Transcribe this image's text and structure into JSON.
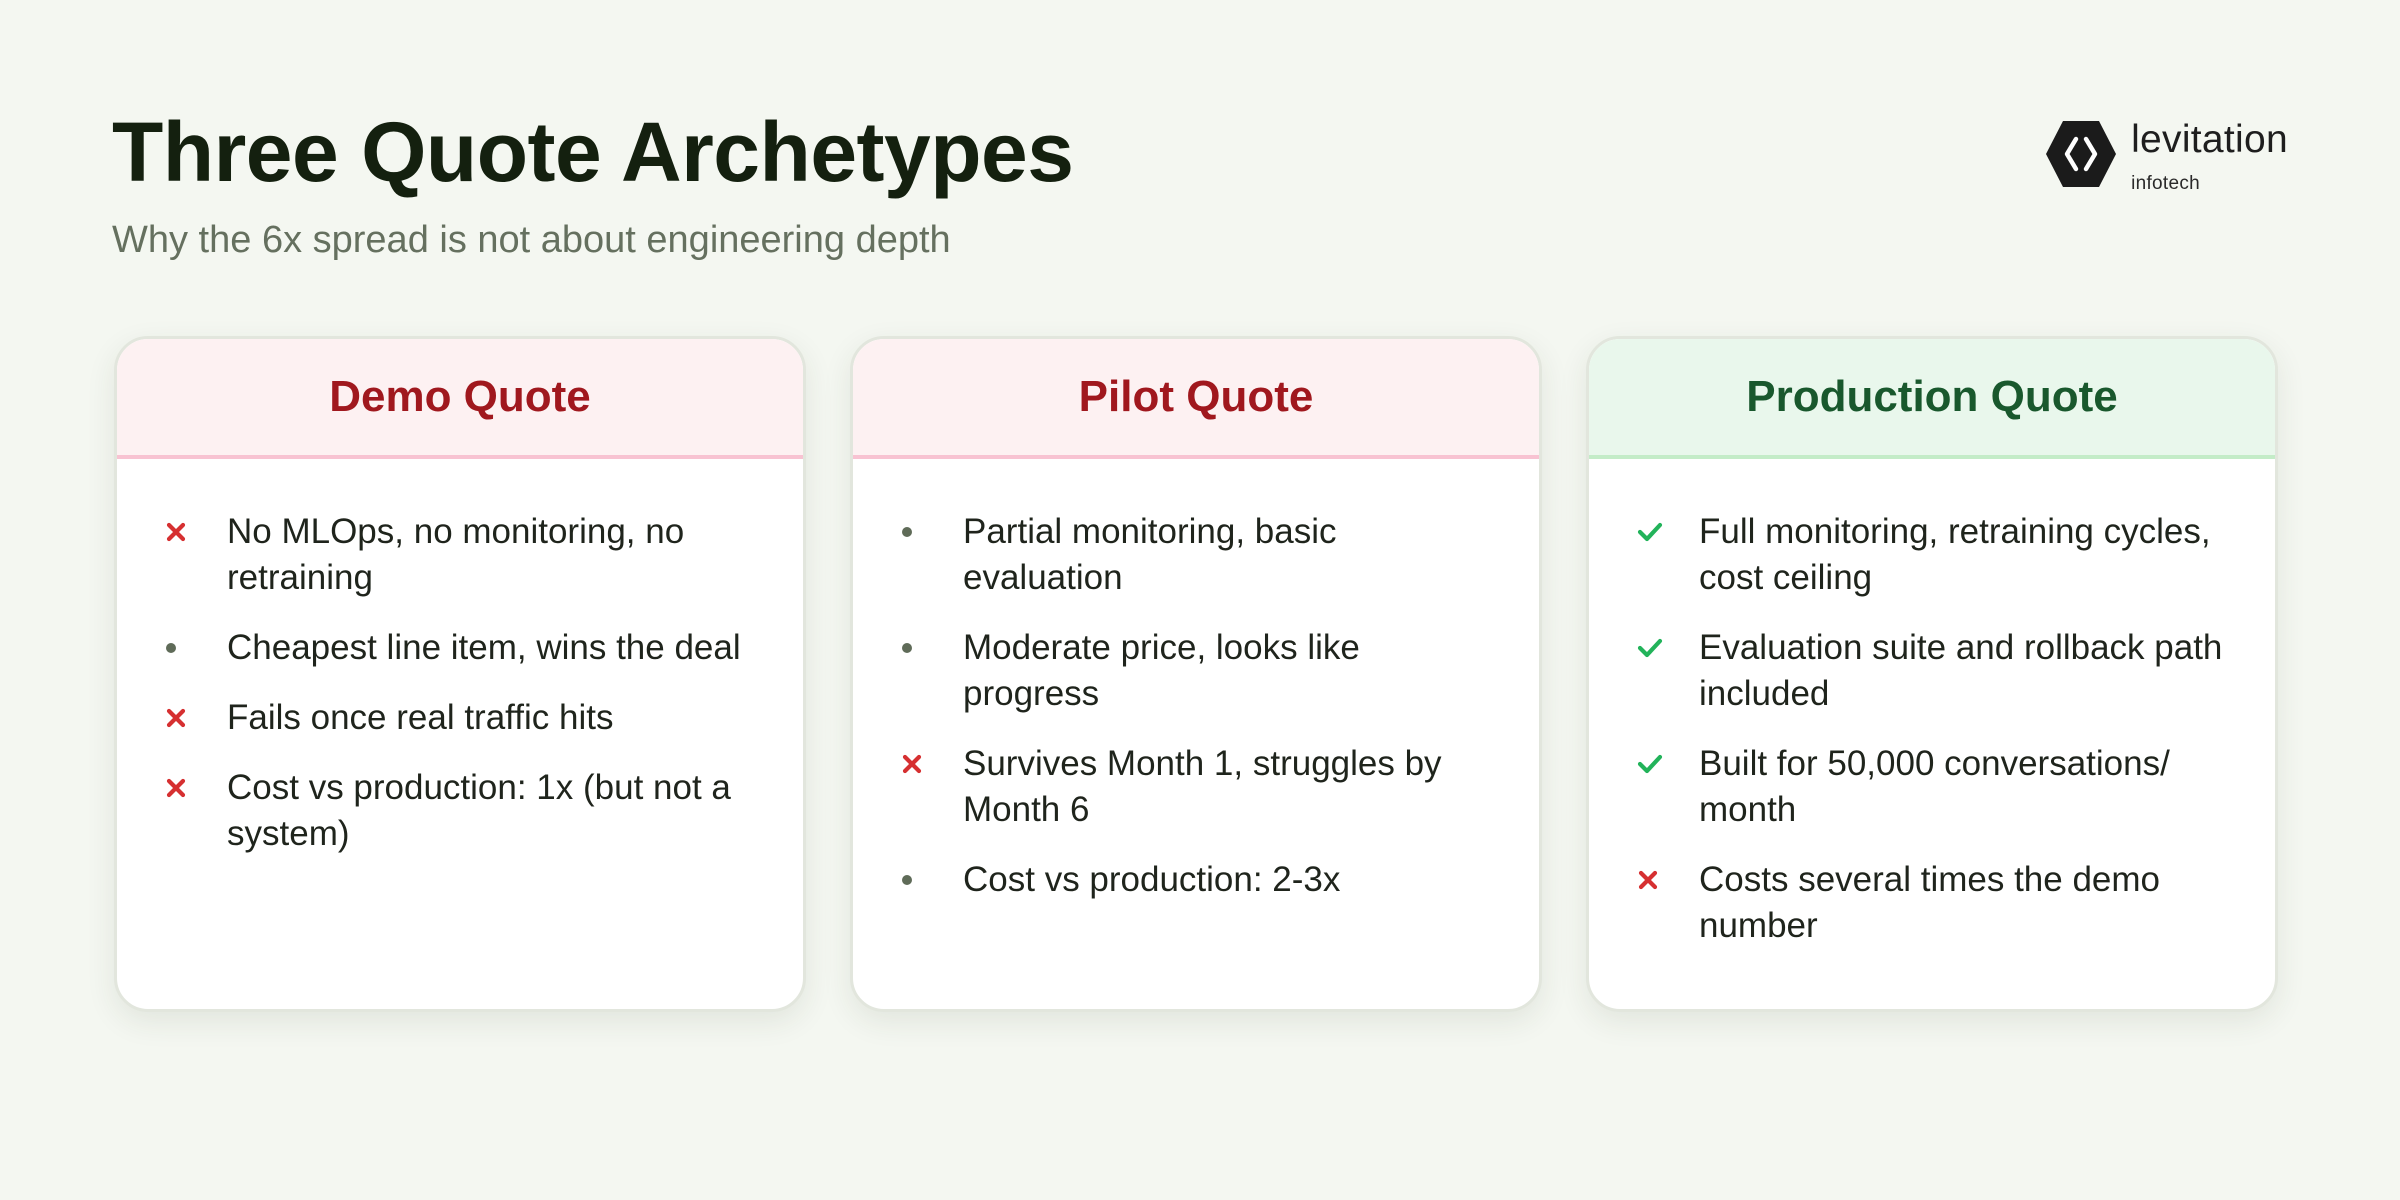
{
  "header": {
    "title": "Three Quote Archetypes",
    "subtitle": "Why the 6x spread is not about engineering depth"
  },
  "logo": {
    "name": "levitation",
    "sub": "infotech",
    "icon": "hexagon-chevrons-logo-icon"
  },
  "colors": {
    "background": "#f4f7f1",
    "bad_accent": "#a0181e",
    "good_accent": "#19582d",
    "cross": "#d63031",
    "check": "#22b35a",
    "bullet": "#5f6b58"
  },
  "cards": [
    {
      "title": "Demo Quote",
      "items": [
        {
          "marker": "cross-icon",
          "text": "No MLOps, no monitoring, no retraining"
        },
        {
          "marker": "bullet-icon",
          "text": "Cheapest line item, wins the deal"
        },
        {
          "marker": "cross-icon",
          "text": "Fails once real traffic hits"
        },
        {
          "marker": "cross-icon",
          "text": "Cost vs production: 1x (but not a system)"
        }
      ]
    },
    {
      "title": "Pilot Quote",
      "items": [
        {
          "marker": "bullet-icon",
          "text": "Partial monitoring, basic evaluation"
        },
        {
          "marker": "bullet-icon",
          "text": "Moderate price, looks like progress"
        },
        {
          "marker": "cross-icon",
          "text": "Survives Month 1, struggles by Month 6"
        },
        {
          "marker": "bullet-icon",
          "text": "Cost vs production: 2-3x"
        }
      ]
    },
    {
      "title": "Production Quote",
      "items": [
        {
          "marker": "check-icon",
          "text": "Full monitoring, retraining cycles, cost ceiling"
        },
        {
          "marker": "check-icon",
          "text": "Evaluation suite and rollback path included"
        },
        {
          "marker": "check-icon",
          "text": "Built for 50,000 conversations/ month"
        },
        {
          "marker": "cross-icon",
          "text": "Costs several times the demo number"
        }
      ]
    }
  ]
}
